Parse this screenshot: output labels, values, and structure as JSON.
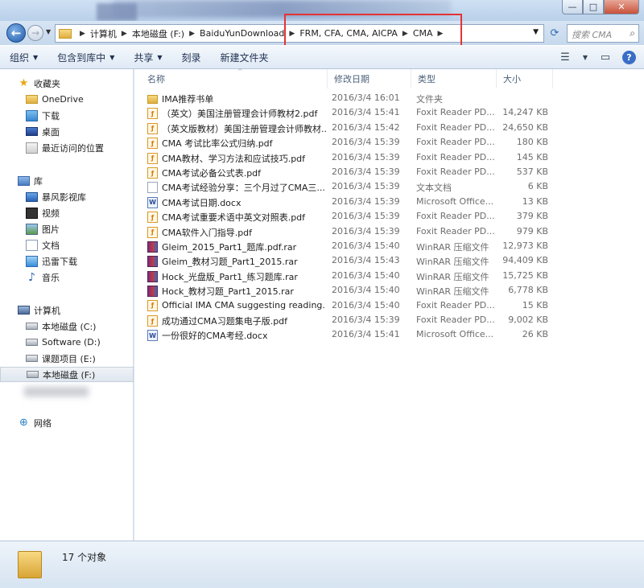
{
  "window": {
    "minimize_label": "—",
    "maximize_label": "□",
    "close_label": "✕"
  },
  "nav": {
    "breadcrumbs": [
      "计算机",
      "本地磁盘 (F:)",
      "BaiduYunDownload",
      "FRM, CFA, CMA, AICPA",
      "CMA"
    ],
    "search_placeholder": "搜索 CMA"
  },
  "toolbar": {
    "organize": "组织",
    "include_in_library": "包含到库中",
    "share": "共享",
    "burn": "刻录",
    "new_folder": "新建文件夹"
  },
  "sidebar": {
    "favorites": "收藏夹",
    "favorites_items": [
      "OneDrive",
      "下载",
      "桌面",
      "最近访问的位置"
    ],
    "libraries": "库",
    "library_items": [
      "暴风影视库",
      "视频",
      "图片",
      "文档",
      "迅雷下载",
      "音乐"
    ],
    "computer": "计算机",
    "computer_items": [
      "本地磁盘 (C:)",
      "Software (D:)",
      "课题项目 (E:)",
      "本地磁盘 (F:)"
    ],
    "network": "网络"
  },
  "columns": {
    "name": "名称",
    "date": "修改日期",
    "type": "类型",
    "size": "大小"
  },
  "files": [
    {
      "name": "IMA推荐书单",
      "date": "2016/3/4 16:01",
      "type": "文件夹",
      "size": "",
      "kind": "folder"
    },
    {
      "name": "（英文）美国注册管理会计师教材2.pdf",
      "date": "2016/3/4 15:41",
      "type": "Foxit Reader PD...",
      "size": "14,247 KB",
      "kind": "pdf"
    },
    {
      "name": "（英文版教材）美国注册管理会计师教材...",
      "date": "2016/3/4 15:42",
      "type": "Foxit Reader PD...",
      "size": "24,650 KB",
      "kind": "pdf"
    },
    {
      "name": "CMA 考试比率公式归纳.pdf",
      "date": "2016/3/4 15:39",
      "type": "Foxit Reader PD...",
      "size": "180 KB",
      "kind": "pdf"
    },
    {
      "name": "CMA教材、学习方法和应试技巧.pdf",
      "date": "2016/3/4 15:39",
      "type": "Foxit Reader PD...",
      "size": "145 KB",
      "kind": "pdf"
    },
    {
      "name": "CMA考试必备公式表.pdf",
      "date": "2016/3/4 15:39",
      "type": "Foxit Reader PD...",
      "size": "537 KB",
      "kind": "pdf"
    },
    {
      "name": "CMA考试经验分享：三个月过了CMA三...",
      "date": "2016/3/4 15:39",
      "type": "文本文档",
      "size": "6 KB",
      "kind": "txt"
    },
    {
      "name": "CMA考试日期.docx",
      "date": "2016/3/4 15:39",
      "type": "Microsoft Office...",
      "size": "13 KB",
      "kind": "docx"
    },
    {
      "name": "CMA考试重要术语中英文对照表.pdf",
      "date": "2016/3/4 15:39",
      "type": "Foxit Reader PD...",
      "size": "379 KB",
      "kind": "pdf"
    },
    {
      "name": "CMA软件入门指导.pdf",
      "date": "2016/3/4 15:39",
      "type": "Foxit Reader PD...",
      "size": "979 KB",
      "kind": "pdf"
    },
    {
      "name": "Gleim_2015_Part1_题库.pdf.rar",
      "date": "2016/3/4 15:40",
      "type": "WinRAR 压缩文件",
      "size": "12,973 KB",
      "kind": "rar"
    },
    {
      "name": "Gleim_教材习题_Part1_2015.rar",
      "date": "2016/3/4 15:43",
      "type": "WinRAR 压缩文件",
      "size": "94,409 KB",
      "kind": "rar"
    },
    {
      "name": "Hock_光盘版_Part1_练习题库.rar",
      "date": "2016/3/4 15:40",
      "type": "WinRAR 压缩文件",
      "size": "15,725 KB",
      "kind": "rar"
    },
    {
      "name": "Hock_教材习题_Part1_2015.rar",
      "date": "2016/3/4 15:40",
      "type": "WinRAR 压缩文件",
      "size": "6,778 KB",
      "kind": "rar"
    },
    {
      "name": "Official IMA CMA suggesting reading...",
      "date": "2016/3/4 15:40",
      "type": "Foxit Reader PD...",
      "size": "15 KB",
      "kind": "pdf"
    },
    {
      "name": "成功通过CMA习题集电子版.pdf",
      "date": "2016/3/4 15:39",
      "type": "Foxit Reader PD...",
      "size": "9,002 KB",
      "kind": "pdf"
    },
    {
      "name": "一份很好的CMA考经.docx",
      "date": "2016/3/4 15:41",
      "type": "Microsoft Office...",
      "size": "26 KB",
      "kind": "docx"
    }
  ],
  "status": {
    "count": "17 个对象"
  },
  "colors": {
    "highlight_box": "#e53333",
    "folder": "#e0b040"
  }
}
